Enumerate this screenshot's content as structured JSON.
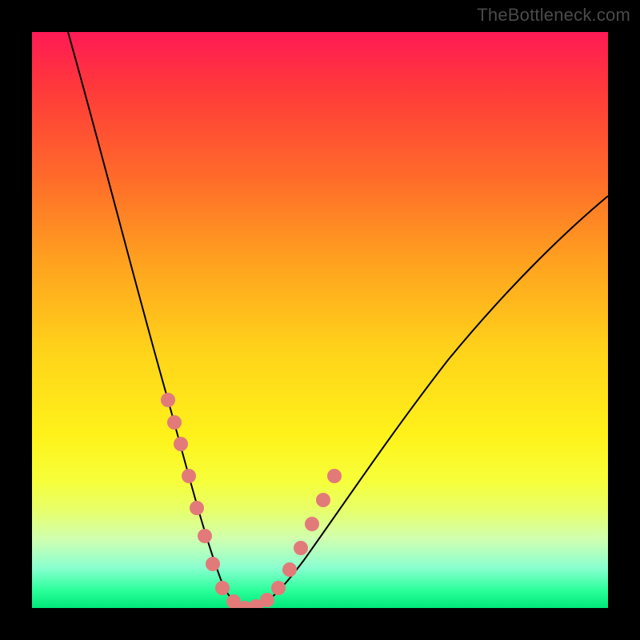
{
  "watermark": "TheBottleneck.com",
  "colors": {
    "page_bg": "#000000",
    "curve": "#000000",
    "dot": "#e27a7a"
  },
  "chart_data": {
    "type": "line",
    "title": "",
    "xlabel": "",
    "ylabel": "",
    "xlim": [
      0,
      100
    ],
    "ylim": [
      0,
      100
    ],
    "grid": false,
    "legend": false,
    "note": "V-shaped bottleneck curve; values estimated from pixel positions (no axis ticks present).",
    "series": [
      {
        "name": "bottleneck-curve",
        "x": [
          6,
          10,
          14,
          18,
          21,
          24,
          26,
          28,
          30,
          32,
          34,
          36,
          39,
          42,
          46,
          50,
          55,
          60,
          66,
          73,
          80,
          88,
          96,
          100
        ],
        "y": [
          100,
          86,
          73,
          61,
          50,
          40,
          31,
          23,
          15,
          8,
          3,
          0,
          0,
          3,
          8,
          14,
          21,
          28,
          36,
          44,
          52,
          60,
          68,
          72
        ]
      }
    ],
    "highlight_points": {
      "name": "marker-dots",
      "x": [
        23.5,
        24.5,
        25.5,
        27.0,
        28.5,
        30.0,
        31.5,
        33.0,
        34.5,
        36.0,
        37.5,
        39.0,
        40.5,
        42.0,
        43.5,
        45.0,
        46.5,
        48.0
      ],
      "y": [
        42,
        38,
        34,
        27,
        20,
        14,
        9,
        5,
        2,
        0,
        0,
        1,
        3,
        6,
        10,
        14,
        19,
        24
      ]
    }
  }
}
